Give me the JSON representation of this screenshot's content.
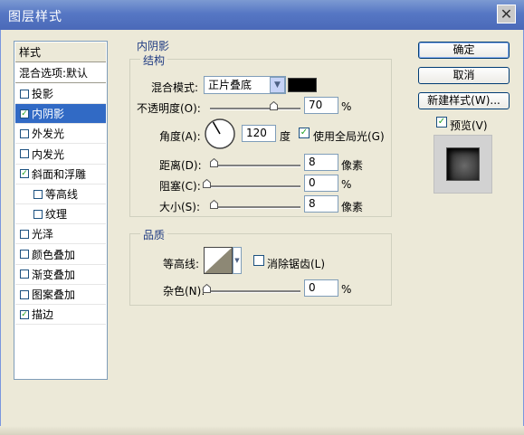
{
  "window": {
    "title": "图层样式",
    "close_glyph": "✕"
  },
  "styles_list": {
    "header": "样式",
    "blend_options": "混合选项:默认",
    "items": [
      {
        "label": "投影",
        "checked": false,
        "selected": false,
        "indent": false
      },
      {
        "label": "内阴影",
        "checked": true,
        "selected": true,
        "indent": false
      },
      {
        "label": "外发光",
        "checked": false,
        "selected": false,
        "indent": false
      },
      {
        "label": "内发光",
        "checked": false,
        "selected": false,
        "indent": false
      },
      {
        "label": "斜面和浮雕",
        "checked": true,
        "selected": false,
        "indent": false
      },
      {
        "label": "等高线",
        "checked": false,
        "selected": false,
        "indent": true
      },
      {
        "label": "纹理",
        "checked": false,
        "selected": false,
        "indent": true
      },
      {
        "label": "光泽",
        "checked": false,
        "selected": false,
        "indent": false
      },
      {
        "label": "颜色叠加",
        "checked": false,
        "selected": false,
        "indent": false
      },
      {
        "label": "渐变叠加",
        "checked": false,
        "selected": false,
        "indent": false
      },
      {
        "label": "图案叠加",
        "checked": false,
        "selected": false,
        "indent": false
      },
      {
        "label": "描边",
        "checked": true,
        "selected": false,
        "indent": false
      }
    ]
  },
  "inner_shadow": {
    "section_title": "内阴影",
    "structure_title": "结构",
    "blend_mode_label": "混合模式:",
    "blend_mode_value": "正片叠底",
    "color": "#000000",
    "opacity_label": "不透明度(O):",
    "opacity_value": "70",
    "opacity_unit": "%",
    "opacity_fraction": 0.7,
    "angle_label": "角度(A):",
    "angle_value": "120",
    "angle_unit": "度",
    "global_light_label": "使用全局光(G)",
    "global_light_checked": true,
    "distance_label": "距离(D):",
    "distance_value": "8",
    "distance_unit": "像素",
    "choke_label": "阻塞(C):",
    "choke_value": "0",
    "choke_unit": "%",
    "size_label": "大小(S):",
    "size_value": "8",
    "size_unit": "像素"
  },
  "quality": {
    "title": "品质",
    "contour_label": "等高线:",
    "anti_alias_label": "消除锯齿(L)",
    "anti_alias_checked": false,
    "noise_label": "杂色(N):",
    "noise_value": "0",
    "noise_unit": "%"
  },
  "buttons": {
    "ok": "确定",
    "cancel": "取消",
    "new_style": "新建样式(W)...",
    "preview_label": "预览(V)",
    "preview_checked": true
  }
}
